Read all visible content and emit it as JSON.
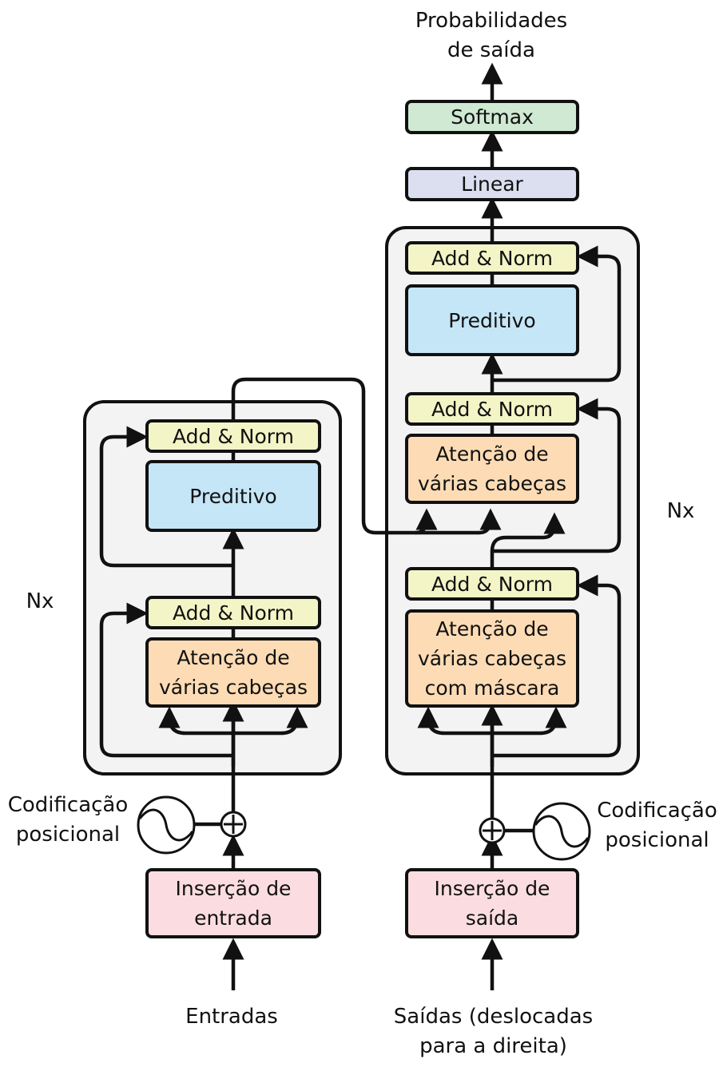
{
  "output": {
    "title_line1": "Probabilidades",
    "title_line2": "de saída"
  },
  "decoder_head": {
    "softmax": "Softmax",
    "linear": "Linear"
  },
  "encoder": {
    "repeat_label": "Nx",
    "add_norm_top": "Add & Norm",
    "feed_forward": "Preditivo",
    "add_norm_bottom": "Add & Norm",
    "attention_line1": "Atenção de",
    "attention_line2": "várias cabeças",
    "positional_line1": "Codificação",
    "positional_line2": "posicional",
    "embedding_line1": "Inserção de",
    "embedding_line2": "entrada",
    "input_label": "Entradas"
  },
  "decoder": {
    "repeat_label": "Nx",
    "add_norm_top": "Add & Norm",
    "feed_forward": "Preditivo",
    "add_norm_middle": "Add & Norm",
    "cross_attention_line1": "Atenção de",
    "cross_attention_line2": "várias cabeças",
    "add_norm_bottom": "Add & Norm",
    "masked_attention_line1": "Atenção de",
    "masked_attention_line2": "várias cabeças",
    "masked_attention_line3": "com máscara",
    "positional_line1": "Codificação",
    "positional_line2": "posicional",
    "embedding_line1": "Inserção de",
    "embedding_line2": "saída",
    "input_line1": "Saídas (deslocadas",
    "input_line2": "para a direita)"
  }
}
